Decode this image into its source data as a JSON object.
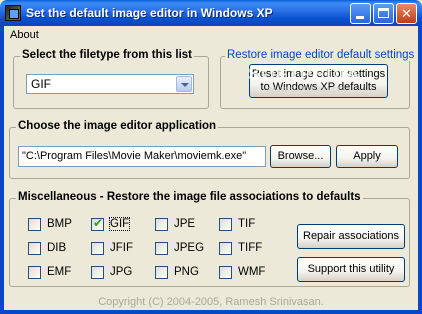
{
  "window": {
    "title": "Set the default image editor in Windows XP",
    "minimize": "_",
    "maximize": "□",
    "close": "✕"
  },
  "menu": {
    "about": "About"
  },
  "filetype": {
    "label": "Select the filetype from this list",
    "selected": "GIF"
  },
  "restore": {
    "label": "Restore image editor default settings",
    "button_line1": "Reset image editor settings",
    "button_line2": "to Windows XP defaults"
  },
  "editor": {
    "label": "Choose the image editor application",
    "path": "\"C:\\Program Files\\Movie Maker\\moviemk.exe\"",
    "browse": "Browse...",
    "apply": "Apply"
  },
  "misc": {
    "label": "Miscellaneous -  Restore the image file associations to defaults",
    "checkboxes": [
      {
        "label": "BMP",
        "checked": false
      },
      {
        "label": "GIF",
        "checked": true
      },
      {
        "label": "JPE",
        "checked": false
      },
      {
        "label": "TIF",
        "checked": false
      },
      {
        "label": "DIB",
        "checked": false
      },
      {
        "label": "JFIF",
        "checked": false
      },
      {
        "label": "JPEG",
        "checked": false
      },
      {
        "label": "TIFF",
        "checked": false
      },
      {
        "label": "EMF",
        "checked": false
      },
      {
        "label": "JPG",
        "checked": false
      },
      {
        "label": "PNG",
        "checked": false
      },
      {
        "label": "WMF",
        "checked": false
      }
    ],
    "repair_button": "Repair associations",
    "support_button": "Support this utility"
  },
  "footer": "Copyright (C) 2004-2005, Ramesh Srinivasan.",
  "watermark": {
    "text": "SOFTPEDIA",
    "url": "www.softpedia.com"
  },
  "colors": {
    "titlebar": "#0a5fd8",
    "face": "#ece9d8",
    "checkmark": "#21a121"
  }
}
